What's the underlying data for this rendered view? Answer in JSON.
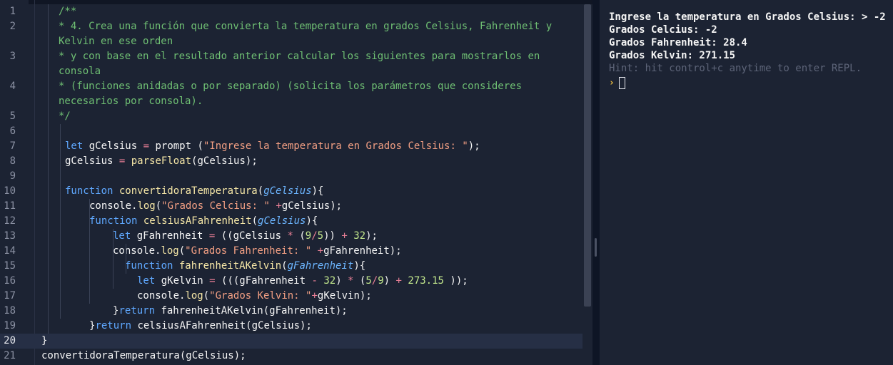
{
  "editor": {
    "lines": [
      {
        "n": "1",
        "segs": [
          {
            "c": "cm",
            "t": "/**"
          }
        ]
      },
      {
        "n": "2",
        "segs": [
          {
            "c": "cm",
            "t": "* 4. Crea una función que convierta la temperatura en grados Celsius, Fahrenheit y"
          }
        ]
      },
      {
        "n": "",
        "segs": [
          {
            "c": "cm",
            "t": "Kelvin en ese orden"
          }
        ]
      },
      {
        "n": "3",
        "segs": [
          {
            "c": "cm",
            "t": "* y con base en el resultado anterior calcular los siguientes para mostrarlos en"
          }
        ]
      },
      {
        "n": "",
        "segs": [
          {
            "c": "cm",
            "t": "consola"
          }
        ]
      },
      {
        "n": "4",
        "segs": [
          {
            "c": "cm",
            "t": "* (funciones anidadas o por separado) (solicita los parámetros que consideres"
          }
        ]
      },
      {
        "n": "",
        "segs": [
          {
            "c": "cm",
            "t": "necesarios por consola)."
          }
        ]
      },
      {
        "n": "5",
        "segs": [
          {
            "c": "cm",
            "t": "*/"
          }
        ]
      },
      {
        "n": "6",
        "segs": []
      },
      {
        "n": "7",
        "segs": [
          {
            "c": "kw",
            "t": "let"
          },
          {
            "c": "pl",
            "t": " gCelsius "
          },
          {
            "c": "op",
            "t": "="
          },
          {
            "c": "pl",
            "t": " prompt ("
          },
          {
            "c": "str",
            "t": "\"Ingrese la temperatura en Grados Celsius: \""
          },
          {
            "c": "pl",
            "t": ");"
          }
        ]
      },
      {
        "n": "8",
        "segs": [
          {
            "c": "pl",
            "t": "gCelsius "
          },
          {
            "c": "op",
            "t": "="
          },
          {
            "c": "pl",
            "t": " "
          },
          {
            "c": "fn",
            "t": "parseFloat"
          },
          {
            "c": "pl",
            "t": "(gCelsius);"
          }
        ]
      },
      {
        "n": "9",
        "segs": []
      },
      {
        "n": "10",
        "segs": [
          {
            "c": "kw",
            "t": "function"
          },
          {
            "c": "pl",
            "t": " "
          },
          {
            "c": "fn",
            "t": "convertidoraTemperatura"
          },
          {
            "c": "pl",
            "t": "("
          },
          {
            "c": "prm",
            "t": "gCelsius"
          },
          {
            "c": "pl",
            "t": "){"
          }
        ]
      },
      {
        "n": "11",
        "segs": [
          {
            "c": "pl",
            "t": "console."
          },
          {
            "c": "fn",
            "t": "log"
          },
          {
            "c": "pl",
            "t": "("
          },
          {
            "c": "str",
            "t": "\"Grados Celcius: \""
          },
          {
            "c": "pl",
            "t": " "
          },
          {
            "c": "op",
            "t": "+"
          },
          {
            "c": "pl",
            "t": "gCelsius);"
          }
        ]
      },
      {
        "n": "12",
        "segs": [
          {
            "c": "kw",
            "t": "function"
          },
          {
            "c": "pl",
            "t": " "
          },
          {
            "c": "fn",
            "t": "celsiusAFahrenheit"
          },
          {
            "c": "pl",
            "t": "("
          },
          {
            "c": "prm",
            "t": "gCelsius"
          },
          {
            "c": "pl",
            "t": "){"
          }
        ]
      },
      {
        "n": "13",
        "segs": [
          {
            "c": "kw",
            "t": "let"
          },
          {
            "c": "pl",
            "t": " gFahrenheit "
          },
          {
            "c": "op",
            "t": "="
          },
          {
            "c": "pl",
            "t": " ((gCelsius "
          },
          {
            "c": "op",
            "t": "*"
          },
          {
            "c": "pl",
            "t": " ("
          },
          {
            "c": "num",
            "t": "9"
          },
          {
            "c": "op",
            "t": "/"
          },
          {
            "c": "num",
            "t": "5"
          },
          {
            "c": "pl",
            "t": ")) "
          },
          {
            "c": "op",
            "t": "+"
          },
          {
            "c": "pl",
            "t": " "
          },
          {
            "c": "num",
            "t": "32"
          },
          {
            "c": "pl",
            "t": ");"
          }
        ]
      },
      {
        "n": "14",
        "segs": [
          {
            "c": "pl",
            "t": "console."
          },
          {
            "c": "fn",
            "t": "log"
          },
          {
            "c": "pl",
            "t": "("
          },
          {
            "c": "str",
            "t": "\"Grados Fahrenheit: \""
          },
          {
            "c": "pl",
            "t": " "
          },
          {
            "c": "op",
            "t": "+"
          },
          {
            "c": "pl",
            "t": "gFahrenheit);"
          }
        ]
      },
      {
        "n": "15",
        "segs": [
          {
            "c": "kw",
            "t": "function"
          },
          {
            "c": "pl",
            "t": " "
          },
          {
            "c": "fn",
            "t": "fahrenheitAKelvin"
          },
          {
            "c": "pl",
            "t": "("
          },
          {
            "c": "prm",
            "t": "gFahrenheit"
          },
          {
            "c": "pl",
            "t": "){"
          }
        ]
      },
      {
        "n": "16",
        "segs": [
          {
            "c": "kw",
            "t": "let"
          },
          {
            "c": "pl",
            "t": " gKelvin "
          },
          {
            "c": "op",
            "t": "="
          },
          {
            "c": "pl",
            "t": " (((gFahrenheit "
          },
          {
            "c": "op",
            "t": "-"
          },
          {
            "c": "pl",
            "t": " "
          },
          {
            "c": "num",
            "t": "32"
          },
          {
            "c": "pl",
            "t": ") "
          },
          {
            "c": "op",
            "t": "*"
          },
          {
            "c": "pl",
            "t": " ("
          },
          {
            "c": "num",
            "t": "5"
          },
          {
            "c": "op",
            "t": "/"
          },
          {
            "c": "num",
            "t": "9"
          },
          {
            "c": "pl",
            "t": ") "
          },
          {
            "c": "op",
            "t": "+"
          },
          {
            "c": "pl",
            "t": " "
          },
          {
            "c": "num",
            "t": "273.15"
          },
          {
            "c": "pl",
            "t": " ));"
          }
        ]
      },
      {
        "n": "17",
        "segs": [
          {
            "c": "pl",
            "t": "console."
          },
          {
            "c": "fn",
            "t": "log"
          },
          {
            "c": "pl",
            "t": "("
          },
          {
            "c": "str",
            "t": "\"Grados Kelvin: \""
          },
          {
            "c": "op",
            "t": "+"
          },
          {
            "c": "pl",
            "t": "gKelvin);"
          }
        ]
      },
      {
        "n": "18",
        "segs": [
          {
            "c": "pl",
            "t": "}"
          },
          {
            "c": "kw",
            "t": "return"
          },
          {
            "c": "pl",
            "t": " fahrenheitAKelvin(gFahrenheit);"
          }
        ]
      },
      {
        "n": "19",
        "segs": [
          {
            "c": "pl",
            "t": "}"
          },
          {
            "c": "kw",
            "t": "return"
          },
          {
            "c": "pl",
            "t": " celsiusAFahrenheit(gCelsius);"
          }
        ]
      },
      {
        "n": "20",
        "segs": [
          {
            "c": "pl",
            "t": "}"
          }
        ]
      },
      {
        "n": "21",
        "segs": [
          {
            "c": "pl",
            "t": "convertidoraTemperatura(gCelsius);"
          }
        ]
      }
    ]
  },
  "console": {
    "output": [
      "Ingrese la temperatura en Grados Celsius: > -2",
      "Grados Celcius: -2",
      "Grados Fahrenheit: 28.4",
      "Grados Kelvin: 271.15"
    ],
    "hint": "Hint: hit control+c anytime to enter REPL.",
    "prompt_symbol": "›"
  },
  "colors": {
    "background": "#1c2333",
    "comment": "#6fbf73",
    "keyword": "#5fa8ff",
    "string": "#f29f83",
    "number": "#c3e88d",
    "function": "#f6e7a7",
    "operator": "#e87f96",
    "prompt": "#f0c040"
  },
  "icons": {
    "prompt": "chevron-right-icon"
  }
}
